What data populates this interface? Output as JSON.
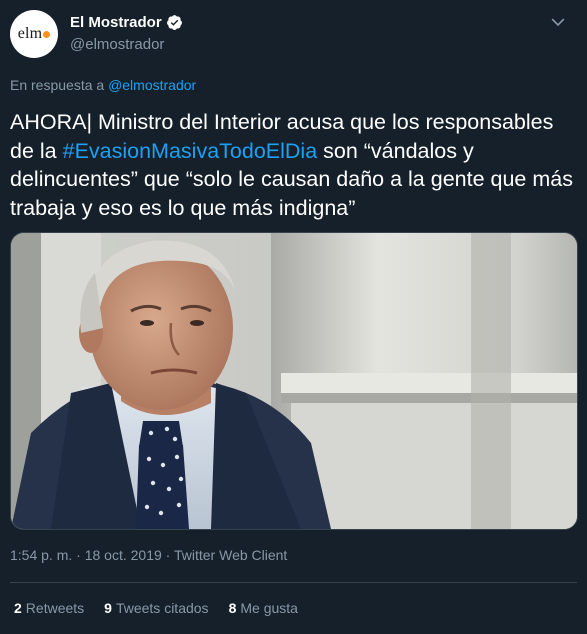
{
  "header": {
    "avatar_text": "elm",
    "name": "El Mostrador",
    "handle": "@elmostrador"
  },
  "reply": {
    "prefix": "En respuesta a",
    "mention": "@elmostrador"
  },
  "tweet": {
    "text_before": "AHORA| Ministro del Interior acusa que los responsables de la ",
    "hashtag": "#EvasionMasivaTodoElDia",
    "text_after": " son “vándalos y delincuentes” que “solo le causan daño a la gente que más trabaja y eso es lo que más indigna”"
  },
  "meta": {
    "time": "1:54 p. m.",
    "date": "18 oct. 2019",
    "client": "Twitter Web Client",
    "separator": "·"
  },
  "stats": [
    {
      "count": "2",
      "label": "Retweets"
    },
    {
      "count": "9",
      "label": "Tweets citados"
    },
    {
      "count": "8",
      "label": "Me gusta"
    }
  ],
  "icons": {
    "verified": "verified-badge-icon",
    "caret": "chevron-down-icon"
  },
  "colors": {
    "background": "#15202b",
    "link": "#1da1f2",
    "muted": "#8899a6",
    "logo_dot": "#f7931e"
  }
}
